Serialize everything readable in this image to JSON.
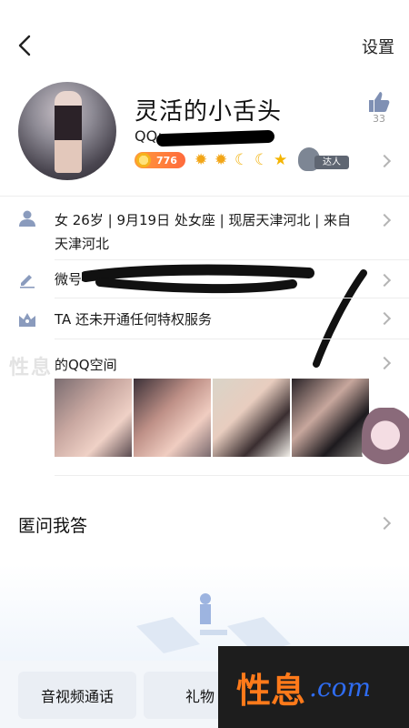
{
  "nav": {
    "settings_label": "设置"
  },
  "profile": {
    "nickname": "灵活的小舌头",
    "qq_prefix": "QQ:",
    "like_count": "33",
    "coin_value": "776",
    "level_icons": [
      "sun-icon",
      "sun-icon",
      "moon-icon",
      "moon-icon",
      "star-icon"
    ],
    "badge_label": "达人"
  },
  "rows": {
    "info": "女 26岁 | 9月19日 处女座 | 现居天津河北 | 来自天津河北",
    "wechat_prefix": "微号",
    "privilege": "TA 还未开通任何特权服务",
    "space": "的QQ空间"
  },
  "qa": {
    "title": "匿问我答"
  },
  "bottom": {
    "call_label": "音视频通话",
    "gift_label": "礼物"
  },
  "watermark": {
    "zh": "性息",
    "en": ".com",
    "faint": "性息"
  }
}
